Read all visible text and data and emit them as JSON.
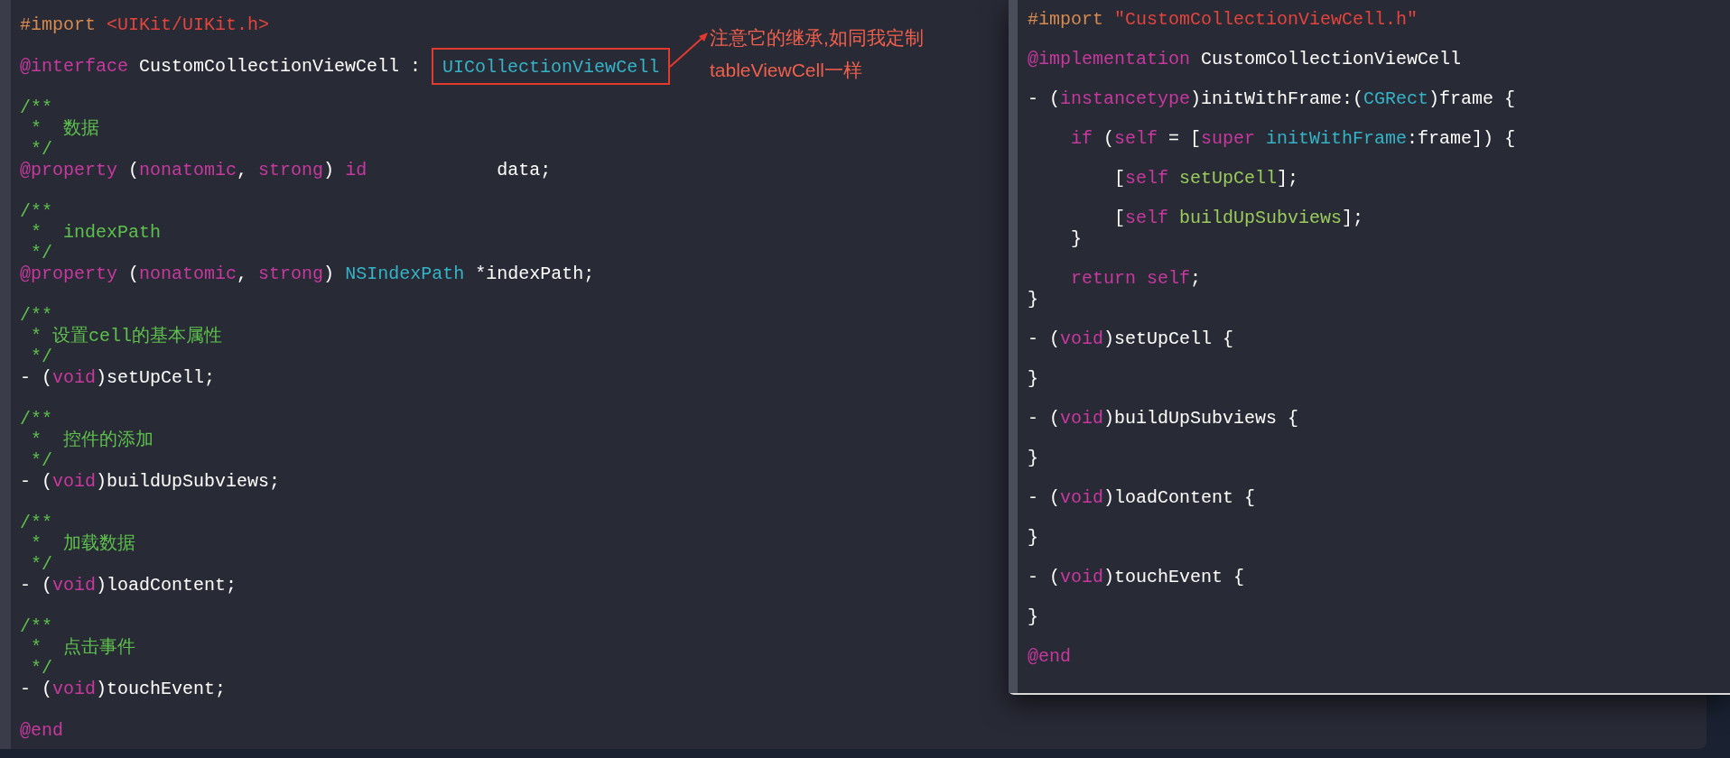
{
  "editors": [
    {
      "blocks": [
        [
          [
            {
              "text": "#import ",
              "kind": "preproc"
            },
            {
              "text": "<UIKit/UIKit.h>",
              "kind": "string"
            }
          ]
        ],
        [
          [
            {
              "text": "@interface",
              "kind": "keyword"
            },
            {
              "text": " CustomCollectionViewCell : ",
              "kind": "plain"
            },
            {
              "text": "UICollectionViewCell",
              "kind": "type",
              "highlighted": true
            }
          ]
        ],
        [
          [
            {
              "text": "/**",
              "kind": "comment"
            }
          ],
          [
            {
              "text": " *  数据",
              "kind": "comment"
            }
          ],
          [
            {
              "text": " */",
              "kind": "comment"
            }
          ],
          [
            {
              "text": "@property",
              "kind": "keyword"
            },
            {
              "text": " (",
              "kind": "plain"
            },
            {
              "text": "nonatomic",
              "kind": "keyword"
            },
            {
              "text": ", ",
              "kind": "plain"
            },
            {
              "text": "strong",
              "kind": "keyword"
            },
            {
              "text": ") ",
              "kind": "plain"
            },
            {
              "text": "id",
              "kind": "keyword"
            },
            {
              "text": "            data;",
              "kind": "plain"
            }
          ]
        ],
        [
          [
            {
              "text": "/**",
              "kind": "comment"
            }
          ],
          [
            {
              "text": " *  indexPath",
              "kind": "comment"
            }
          ],
          [
            {
              "text": " */",
              "kind": "comment"
            }
          ],
          [
            {
              "text": "@property",
              "kind": "keyword"
            },
            {
              "text": " (",
              "kind": "plain"
            },
            {
              "text": "nonatomic",
              "kind": "keyword"
            },
            {
              "text": ", ",
              "kind": "plain"
            },
            {
              "text": "strong",
              "kind": "keyword"
            },
            {
              "text": ") ",
              "kind": "plain"
            },
            {
              "text": "NSIndexPath",
              "kind": "type"
            },
            {
              "text": " *indexPath;",
              "kind": "plain"
            }
          ]
        ],
        [
          [
            {
              "text": "/**",
              "kind": "comment"
            }
          ],
          [
            {
              "text": " * 设置cell的基本属性",
              "kind": "comment"
            }
          ],
          [
            {
              "text": " */",
              "kind": "comment"
            }
          ],
          [
            {
              "text": "- (",
              "kind": "plain"
            },
            {
              "text": "void",
              "kind": "keyword"
            },
            {
              "text": ")setUpCell;",
              "kind": "plain"
            }
          ]
        ],
        [
          [
            {
              "text": "/**",
              "kind": "comment"
            }
          ],
          [
            {
              "text": " *  控件的添加",
              "kind": "comment"
            }
          ],
          [
            {
              "text": " */",
              "kind": "comment"
            }
          ],
          [
            {
              "text": "- (",
              "kind": "plain"
            },
            {
              "text": "void",
              "kind": "keyword"
            },
            {
              "text": ")buildUpSubviews;",
              "kind": "plain"
            }
          ]
        ],
        [
          [
            {
              "text": "/**",
              "kind": "comment"
            }
          ],
          [
            {
              "text": " *  加载数据",
              "kind": "comment"
            }
          ],
          [
            {
              "text": " */",
              "kind": "comment"
            }
          ],
          [
            {
              "text": "- (",
              "kind": "plain"
            },
            {
              "text": "void",
              "kind": "keyword"
            },
            {
              "text": ")loadContent;",
              "kind": "plain"
            }
          ]
        ],
        [
          [
            {
              "text": "/**",
              "kind": "comment"
            }
          ],
          [
            {
              "text": " *  点击事件",
              "kind": "comment"
            }
          ],
          [
            {
              "text": " */",
              "kind": "comment"
            }
          ],
          [
            {
              "text": "- (",
              "kind": "plain"
            },
            {
              "text": "void",
              "kind": "keyword"
            },
            {
              "text": ")touchEvent;",
              "kind": "plain"
            }
          ]
        ],
        [
          [
            {
              "text": "@end",
              "kind": "keyword"
            }
          ]
        ]
      ]
    },
    {
      "blocks": [
        [
          [
            {
              "text": "#import ",
              "kind": "preproc"
            },
            {
              "text": "\"CustomCollectionViewCell.h\"",
              "kind": "string"
            }
          ]
        ],
        [
          [
            {
              "text": "@implementation",
              "kind": "keyword"
            },
            {
              "text": " CustomCollectionViewCell",
              "kind": "plain"
            }
          ]
        ],
        [
          [
            {
              "text": "- (",
              "kind": "plain"
            },
            {
              "text": "instancetype",
              "kind": "keyword"
            },
            {
              "text": ")initWithFrame:(",
              "kind": "plain"
            },
            {
              "text": "CGRect",
              "kind": "type"
            },
            {
              "text": ")frame {",
              "kind": "plain"
            }
          ]
        ],
        [
          [
            {
              "text": "    if",
              "kind": "keyword"
            },
            {
              "text": " (",
              "kind": "plain"
            },
            {
              "text": "self",
              "kind": "keyword"
            },
            {
              "text": " = [",
              "kind": "plain"
            },
            {
              "text": "super",
              "kind": "keyword"
            },
            {
              "text": " initWithFrame",
              "kind": "type"
            },
            {
              "text": ":frame]) {",
              "kind": "plain"
            }
          ]
        ],
        [
          [
            {
              "text": "        [",
              "kind": "plain"
            },
            {
              "text": "self",
              "kind": "keyword"
            },
            {
              "text": " setUpCell",
              "kind": "method"
            },
            {
              "text": "];",
              "kind": "plain"
            }
          ]
        ],
        [
          [
            {
              "text": "        [",
              "kind": "plain"
            },
            {
              "text": "self",
              "kind": "keyword"
            },
            {
              "text": " buildUpSubviews",
              "kind": "method"
            },
            {
              "text": "];",
              "kind": "plain"
            }
          ],
          [
            {
              "text": "    }",
              "kind": "plain"
            }
          ]
        ],
        [
          [
            {
              "text": "    return",
              "kind": "keyword"
            },
            {
              "text": " self",
              "kind": "keyword"
            },
            {
              "text": ";",
              "kind": "plain"
            }
          ],
          [
            {
              "text": "}",
              "kind": "plain"
            }
          ]
        ],
        [
          [
            {
              "text": "- (",
              "kind": "plain"
            },
            {
              "text": "void",
              "kind": "keyword"
            },
            {
              "text": ")setUpCell {",
              "kind": "plain"
            }
          ]
        ],
        [
          [
            {
              "text": "}",
              "kind": "plain"
            }
          ]
        ],
        [
          [
            {
              "text": "- (",
              "kind": "plain"
            },
            {
              "text": "void",
              "kind": "keyword"
            },
            {
              "text": ")buildUpSubviews {",
              "kind": "plain"
            }
          ]
        ],
        [
          [
            {
              "text": "}",
              "kind": "plain"
            }
          ]
        ],
        [
          [
            {
              "text": "- (",
              "kind": "plain"
            },
            {
              "text": "void",
              "kind": "keyword"
            },
            {
              "text": ")loadContent {",
              "kind": "plain"
            }
          ]
        ],
        [
          [
            {
              "text": "}",
              "kind": "plain"
            }
          ]
        ],
        [
          [
            {
              "text": "- (",
              "kind": "plain"
            },
            {
              "text": "void",
              "kind": "keyword"
            },
            {
              "text": ")touchEvent {",
              "kind": "plain"
            }
          ]
        ],
        [
          [
            {
              "text": "}",
              "kind": "plain"
            }
          ]
        ],
        [
          [
            {
              "text": "@end",
              "kind": "keyword"
            }
          ]
        ]
      ]
    }
  ],
  "annotation": {
    "lines": [
      "注意它的继承,如同我定制",
      "tableViewCell一样"
    ]
  }
}
